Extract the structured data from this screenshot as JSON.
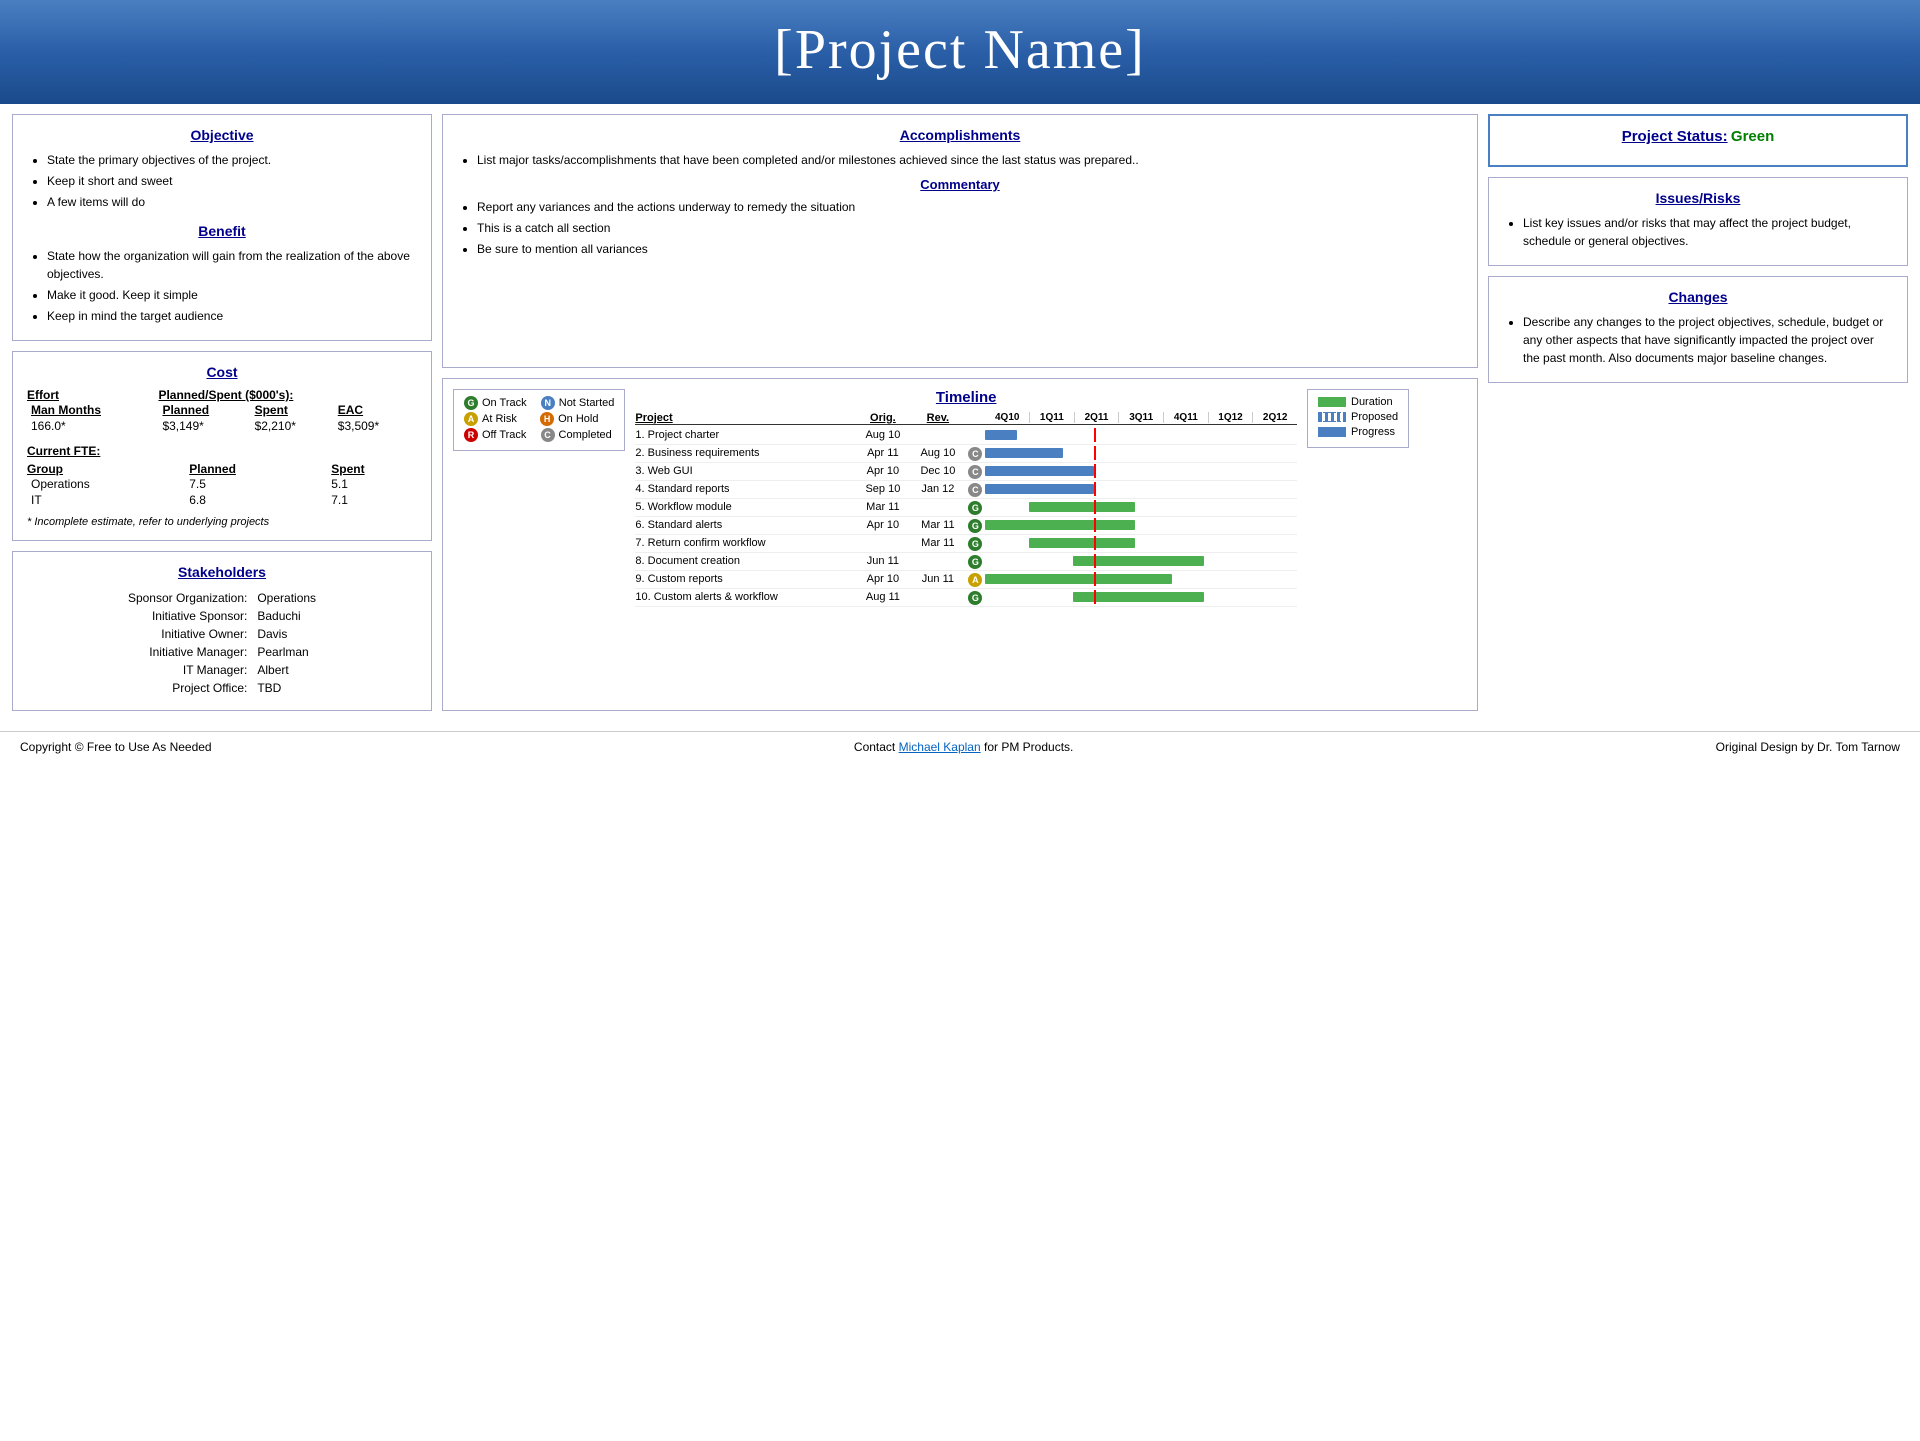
{
  "header": {
    "title": "[Project Name]"
  },
  "objective": {
    "title": "Objective",
    "items": [
      "State the primary objectives of the project.",
      "Keep it short and sweet",
      "A few items will do"
    ]
  },
  "benefit": {
    "title": "Benefit",
    "items": [
      "State how the organization will gain from the realization of the above objectives.",
      "Make it good. Keep it simple",
      "Keep in mind the target audience"
    ]
  },
  "cost": {
    "title": "Cost",
    "effort_label": "Effort",
    "planned_spent_label": "Planned/Spent ($000's):",
    "table_headers": [
      "Man Months",
      "Planned",
      "Spent",
      "EAC"
    ],
    "table_row": [
      "166.0*",
      "$3,149*",
      "$2,210*",
      "$3,509*"
    ],
    "current_fte_label": "Current FTE:",
    "fte_headers": [
      "Group",
      "Planned",
      "Spent"
    ],
    "fte_rows": [
      [
        "Operations",
        "7.5",
        "5.1"
      ],
      [
        "IT",
        "6.8",
        "7.1"
      ]
    ],
    "footnote": "* Incomplete estimate, refer to underlying projects"
  },
  "stakeholders": {
    "title": "Stakeholders",
    "rows": [
      [
        "Sponsor Organization:",
        "Operations"
      ],
      [
        "Initiative Sponsor:",
        "Baduchi"
      ],
      [
        "Initiative Owner:",
        "Davis"
      ],
      [
        "Initiative Manager:",
        "Pearlman"
      ],
      [
        "IT Manager:",
        "Albert"
      ],
      [
        "Project Office:",
        "TBD"
      ]
    ]
  },
  "accomplishments": {
    "title": "Accomplishments",
    "items": [
      "List major tasks/accomplishments that have been completed and/or milestones achieved since the last status was prepared.."
    ]
  },
  "commentary": {
    "title": "Commentary",
    "items": [
      "Report any variances and the actions underway to remedy the situation",
      "This is a catch all section",
      "Be sure to mention all variances"
    ]
  },
  "project_status": {
    "title": "Project Status:",
    "status": "Green",
    "title_full": "Project Status:  Green"
  },
  "issues_risks": {
    "title": "Issues/Risks",
    "items": [
      "List key issues and/or risks that may affect the project budget, schedule or general objectives."
    ]
  },
  "changes": {
    "title": "Changes",
    "items": [
      "Describe any changes to the project objectives, schedule, budget or any other aspects that have significantly impacted the project over the past month. Also documents major baseline changes."
    ]
  },
  "timeline": {
    "title": "Timeline",
    "legend_items": [
      {
        "symbol": "G",
        "color": "lg-green",
        "label": "On Track"
      },
      {
        "symbol": "A",
        "color": "lg-yellow",
        "label": "At Risk"
      },
      {
        "symbol": "R",
        "color": "lg-red",
        "label": "Off Track"
      },
      {
        "symbol": "N",
        "color": "lg-blue",
        "label": "Not Started"
      },
      {
        "symbol": "H",
        "color": "lg-orange",
        "label": "On Hold"
      },
      {
        "symbol": "C",
        "color": "lg-gray",
        "label": "Completed"
      }
    ],
    "duration_legend": [
      {
        "type": "dur-solid",
        "label": "Duration"
      },
      {
        "type": "dur-dashed",
        "label": "Proposed"
      },
      {
        "type": "dur-progress",
        "label": "Progress"
      }
    ],
    "col_headers": [
      "4Q10",
      "1Q11",
      "2Q11",
      "3Q11",
      "4Q11",
      "1Q12",
      "2Q12"
    ],
    "projects": [
      {
        "name": "1. Project charter",
        "orig": "Aug 10",
        "rev": "",
        "status": "",
        "bar_start": 0.0,
        "bar_end": 0.12,
        "bar_type": "blue",
        "status_color": ""
      },
      {
        "name": "2. Business requirements",
        "orig": "Apr 11",
        "rev": "Aug 10",
        "status": "C",
        "status_color": "lg-gray",
        "bar_start": 0.0,
        "bar_end": 0.28,
        "bar_type": "blue"
      },
      {
        "name": "3. Web GUI",
        "orig": "Apr 10",
        "rev": "Dec 10",
        "status": "C",
        "status_color": "lg-gray",
        "bar_start": 0.0,
        "bar_end": 0.42,
        "bar_type": "blue"
      },
      {
        "name": "4. Standard reports",
        "orig": "Sep 10",
        "rev": "Jan 12",
        "status": "C",
        "status_color": "lg-gray",
        "bar_start": 0.0,
        "bar_end": 0.42,
        "bar_type": "blue"
      },
      {
        "name": "5. Workflow module",
        "orig": "Mar 11",
        "rev": "",
        "status": "G",
        "status_color": "lg-green",
        "bar_start": 0.14,
        "bar_end": 0.52,
        "bar_type": "green"
      },
      {
        "name": "6. Standard alerts",
        "orig": "Apr 10",
        "rev": "Mar 11",
        "status": "G",
        "status_color": "lg-green",
        "bar_start": 0.0,
        "bar_end": 0.52,
        "bar_type": "green"
      },
      {
        "name": "7. Return confirm workflow",
        "orig": "",
        "rev": "Mar 11",
        "status": "G",
        "status_color": "lg-green",
        "bar_start": 0.14,
        "bar_end": 0.52,
        "bar_type": "green"
      },
      {
        "name": "8. Document creation",
        "orig": "Jun 11",
        "rev": "",
        "status": "G",
        "status_color": "lg-green",
        "bar_start": 0.28,
        "bar_end": 0.72,
        "bar_type": "green"
      },
      {
        "name": "9. Custom reports",
        "orig": "Apr 10",
        "rev": "Jun 11",
        "status": "A",
        "status_color": "lg-yellow",
        "bar_start": 0.0,
        "bar_end": 0.65,
        "bar_type": "green"
      },
      {
        "name": "10. Custom alerts & workflow",
        "orig": "Aug 11",
        "rev": "",
        "status": "G",
        "status_color": "lg-green",
        "bar_start": 0.28,
        "bar_end": 0.72,
        "bar_type": "green"
      }
    ],
    "today_position": 0.35
  },
  "footer": {
    "left": "Copyright © Free to Use As Needed",
    "middle_prefix": "Contact ",
    "middle_link_text": "Michael Kaplan",
    "middle_link_href": "#",
    "middle_suffix": " for PM Products.",
    "right": "Original Design by Dr. Tom Tarnow"
  }
}
